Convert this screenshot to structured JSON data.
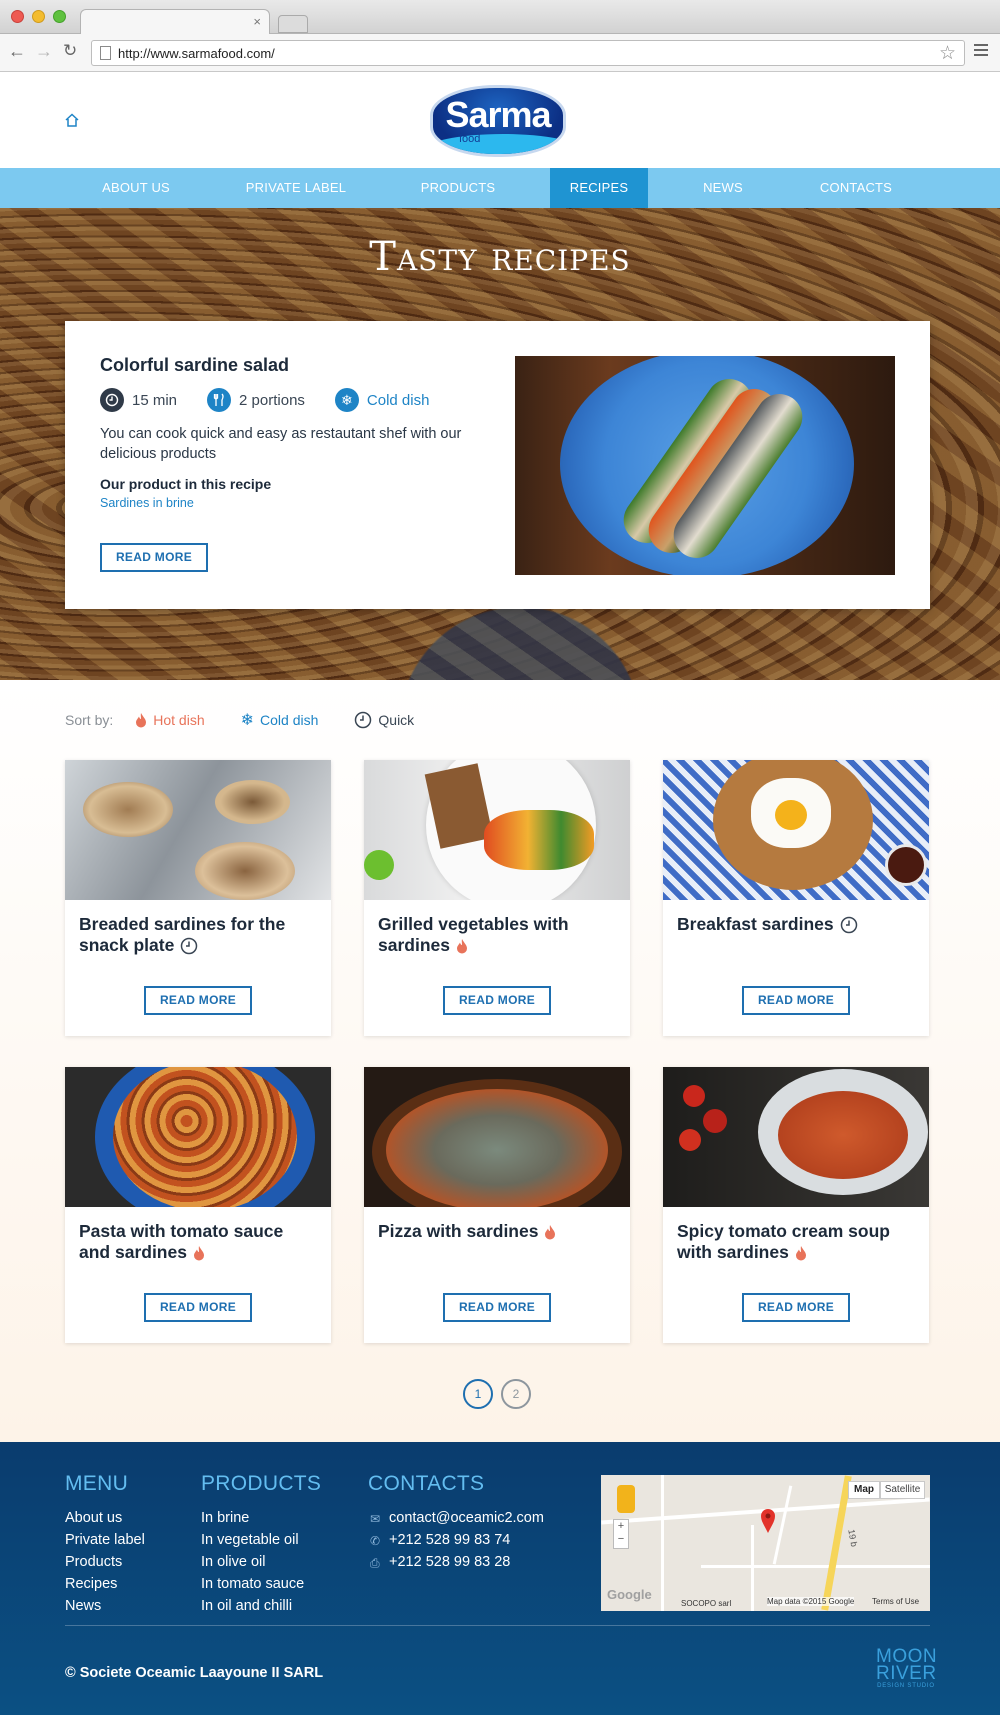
{
  "browser": {
    "url": "http://www.sarmafood.com/",
    "tab_close": "×"
  },
  "header": {
    "logo": {
      "word": "Sarma",
      "sub": "food"
    }
  },
  "nav": {
    "items": [
      {
        "label": "ABOUT US"
      },
      {
        "label": "PRIVATE LABEL"
      },
      {
        "label": "PRODUCTS"
      },
      {
        "label": "RECIPES"
      },
      {
        "label": "NEWS"
      },
      {
        "label": "CONTACTS"
      }
    ],
    "active": "RECIPES"
  },
  "hero": {
    "title": "Tasty recipes",
    "featured": {
      "title": "Colorful sardine salad",
      "time": "15 min",
      "portions": "2 portions",
      "type": "Cold dish",
      "description": "You can cook quick and easy as restautant shef with our delicious products",
      "product_label": "Our product in this recipe",
      "product_link": "Sardines in brine",
      "button": "READ MORE"
    }
  },
  "sort": {
    "label": "Sort by:",
    "options": [
      {
        "label": "Hot dish",
        "icon": "flame-icon",
        "color": "#e8735a"
      },
      {
        "label": "Cold dish",
        "icon": "snowflake-icon",
        "color": "#1e84c6"
      },
      {
        "label": "Quick",
        "icon": "clock-icon",
        "color": "#3a4654"
      }
    ]
  },
  "recipes": [
    {
      "title": "Breaded sardines for the snack plate",
      "badge": "clock-icon",
      "button": "READ MORE"
    },
    {
      "title": "Grilled vegetables with sardines",
      "badge": "flame-icon",
      "button": "READ MORE"
    },
    {
      "title": "Breakfast sardines",
      "badge": "clock-icon",
      "button": "READ MORE"
    },
    {
      "title": "Pasta with tomato sauce and sardines",
      "badge": "flame-icon",
      "button": "READ MORE"
    },
    {
      "title": "Pizza with sardines",
      "badge": "flame-icon",
      "button": "READ MORE"
    },
    {
      "title": "Spicy tomato cream soup with sardines",
      "badge": "flame-icon",
      "button": "READ MORE"
    }
  ],
  "pagination": {
    "pages": [
      "1",
      "2"
    ],
    "current": "1"
  },
  "footer": {
    "menu": {
      "title": "MENU",
      "items": [
        "About us",
        "Private label",
        "Products",
        "Recipes",
        "News"
      ]
    },
    "products": {
      "title": "PRODUCTS",
      "items": [
        "In brine",
        "In vegetable oil",
        "In olive oil",
        "In tomato sauce",
        "In oil and chilli"
      ]
    },
    "contacts": {
      "title": "CONTACTS",
      "email": "contact@oceamic2.com",
      "phone": "+212 528 99 83 74",
      "fax": "+212 528 99 83 28"
    },
    "map": {
      "btn_map": "Map",
      "btn_satellite": "Satellite",
      "zoom_in": "+",
      "zoom_out": "−",
      "google": "Google",
      "attribution": "Map data ©2015 Google",
      "terms": "Terms of Use",
      "place": "SOCOPO sarl",
      "road": "19 b"
    },
    "copyright": "© Societe Oceamic Laayoune II SARL",
    "studio": {
      "line1": "MOON",
      "line2": "RIVER",
      "line3": "DESIGN STUDIO"
    }
  },
  "colors": {
    "nav": "#7cc9f0",
    "nav_active": "#1f94d2",
    "accent_blue": "#1e6fb0",
    "hot": "#e8735a",
    "footer": "#0b4a7c"
  }
}
